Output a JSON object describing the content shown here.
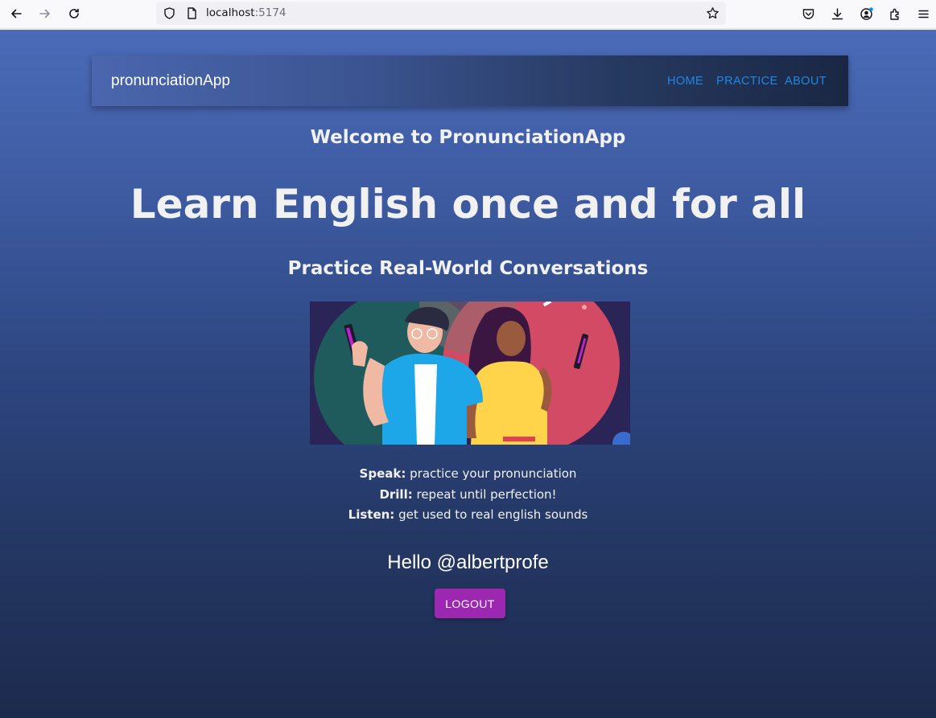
{
  "browser": {
    "url_host": "localhost",
    "url_port": ":5174"
  },
  "appbar": {
    "brand": "pronunciationApp",
    "nav": [
      "HOME",
      "PRACTICE",
      "ABOUT"
    ],
    "nav_color": "#1e88e5"
  },
  "hero": {
    "welcome": "Welcome to PronunciationApp",
    "headline": "Learn English once and for all",
    "subhead": "Practice Real-World Conversations"
  },
  "features": [
    {
      "label": "Speak:",
      "text": " practice your pronunciation"
    },
    {
      "label": "Drill:",
      "text": " repeat until perfection!"
    },
    {
      "label": "Listen:",
      "text": " get used to real english sounds"
    }
  ],
  "user": {
    "greeting": "Hello @albertprofe",
    "logout_label": "LOGOUT",
    "logout_color": "#9c27b0"
  }
}
